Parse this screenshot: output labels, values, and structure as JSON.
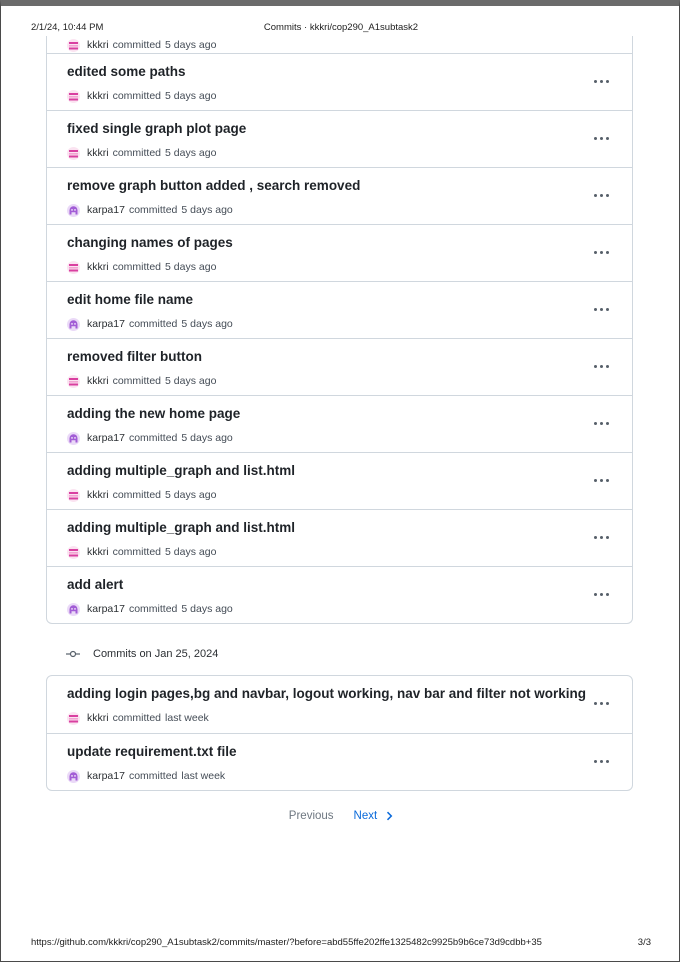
{
  "print_header": {
    "datetime": "2/1/24, 10:44 PM",
    "title": "Commits · kkkri/cop290_A1subtask2"
  },
  "print_footer": {
    "url": "https://github.com/kkkri/cop290_A1subtask2/commits/master/?before=abd55ffe202ffe1325482c9925b9b6ce73d9cdbb+35",
    "page": "3/3"
  },
  "committed_word": "committed",
  "commit_groups": [
    {
      "commits": [
        {
          "message": "",
          "author": "kkkri",
          "time": "5 days ago"
        },
        {
          "message": "edited some paths",
          "author": "kkkri",
          "time": "5 days ago"
        },
        {
          "message": "fixed single graph plot page",
          "author": "kkkri",
          "time": "5 days ago"
        },
        {
          "message": "remove graph button added , search removed",
          "author": "karpa17",
          "time": "5 days ago"
        },
        {
          "message": "changing names of pages",
          "author": "kkkri",
          "time": "5 days ago"
        },
        {
          "message": "edit home file name",
          "author": "karpa17",
          "time": "5 days ago"
        },
        {
          "message": "removed filter button",
          "author": "kkkri",
          "time": "5 days ago"
        },
        {
          "message": "adding the new home page",
          "author": "karpa17",
          "time": "5 days ago"
        },
        {
          "message": "adding multiple_graph and list.html",
          "author": "kkkri",
          "time": "5 days ago"
        },
        {
          "message": "adding multiple_graph and list.html",
          "author": "kkkri",
          "time": "5 days ago"
        },
        {
          "message": "add alert",
          "author": "karpa17",
          "time": "5 days ago"
        }
      ]
    },
    {
      "heading": "Commits on Jan 25, 2024",
      "commits": [
        {
          "message": "adding login pages,bg and navbar, logout working, nav bar and filter not working",
          "author": "kkkri",
          "time": "last week"
        },
        {
          "message": "update requirement.txt file",
          "author": "karpa17",
          "time": "last week"
        }
      ]
    }
  ],
  "pagination": {
    "previous": "Previous",
    "next": "Next"
  },
  "icons": {
    "more": "kebab-horizontal-icon",
    "commit": "git-commit-icon",
    "next": "chevron-right-icon"
  },
  "colors": {
    "link": "#0969da",
    "border": "#d0d7de",
    "avatar_kkkri": "#fbe3f1",
    "avatar_karpa17": "#ead9f7"
  }
}
